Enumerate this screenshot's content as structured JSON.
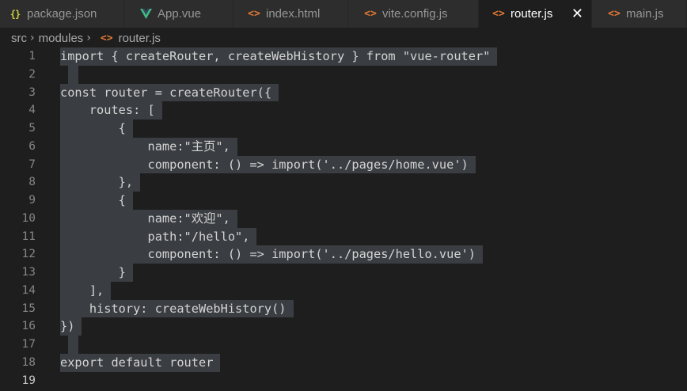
{
  "tabs": [
    {
      "label": "package.json",
      "icon": "json-icon"
    },
    {
      "label": "App.vue",
      "icon": "vue-icon"
    },
    {
      "label": "index.html",
      "icon": "html-icon"
    },
    {
      "label": "vite.config.js",
      "icon": "js-icon"
    },
    {
      "label": "router.js",
      "icon": "js-icon",
      "active": true
    },
    {
      "label": "main.js",
      "icon": "js-icon"
    }
  ],
  "tab_icons": {
    "json": "{}",
    "code": "<>",
    "close": "✕"
  },
  "breadcrumb": {
    "items": [
      "src",
      "modules",
      "router.js"
    ],
    "separator": "›"
  },
  "editor": {
    "current_line": 19,
    "colors": {
      "background": "#1e1e1e",
      "selection": "#3a3d41",
      "text": "#d4d4d4",
      "line_number": "#858585",
      "file_icon_js": "#e37933",
      "file_icon_json": "#cbcb41",
      "file_icon_vue": "#41b883"
    },
    "lines": [
      {
        "n": "1",
        "code": "import { createRouter, createWebHistory } from \"vue-router\""
      },
      {
        "n": "2",
        "code": ""
      },
      {
        "n": "3",
        "code": "const router = createRouter({"
      },
      {
        "n": "4",
        "code": "    routes: ["
      },
      {
        "n": "5",
        "code": "        {"
      },
      {
        "n": "6",
        "code": "            name:\"主页\","
      },
      {
        "n": "7",
        "code": "            component: () => import('../pages/home.vue')"
      },
      {
        "n": "8",
        "code": "        },"
      },
      {
        "n": "9",
        "code": "        {"
      },
      {
        "n": "10",
        "code": "            name:\"欢迎\","
      },
      {
        "n": "11",
        "code": "            path:\"/hello\","
      },
      {
        "n": "12",
        "code": "            component: () => import('../pages/hello.vue')"
      },
      {
        "n": "13",
        "code": "        }"
      },
      {
        "n": "14",
        "code": "    ],"
      },
      {
        "n": "15",
        "code": "    history: createWebHistory()"
      },
      {
        "n": "16",
        "code": "})"
      },
      {
        "n": "17",
        "code": ""
      },
      {
        "n": "18",
        "code": "export default router"
      },
      {
        "n": "19",
        "code": ""
      }
    ]
  }
}
